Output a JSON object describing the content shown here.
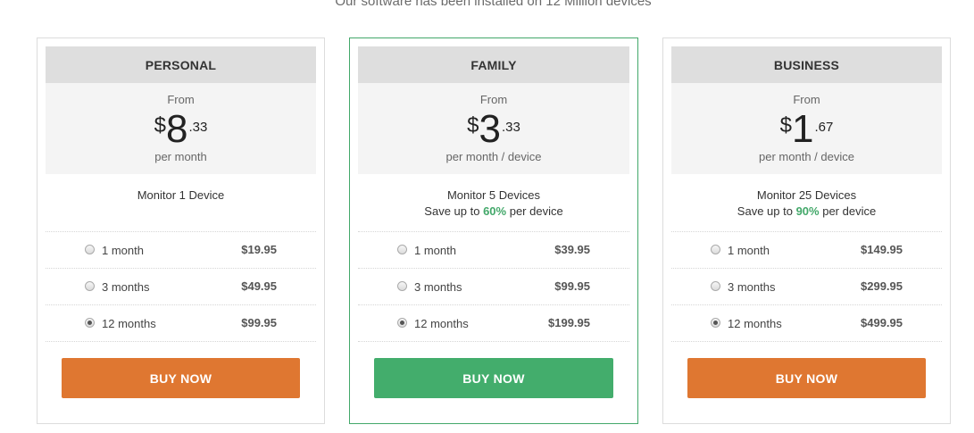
{
  "subtitle": "Our software has been installed on 12 Million devices",
  "colors": {
    "accent_orange": "#df7731",
    "accent_green": "#43ad6c",
    "highlight_pct": "#43a86a"
  },
  "plans": [
    {
      "name": "PERSONAL",
      "from_label": "From",
      "currency": "$",
      "price_whole": "8",
      "price_cents": ".33",
      "period": "per month",
      "desc_line1": "Monitor 1 Device",
      "save_prefix": "",
      "save_pct": "",
      "save_suffix": "",
      "options": [
        {
          "label": "1 month",
          "price": "$19.95",
          "selected": false
        },
        {
          "label": "3 months",
          "price": "$49.95",
          "selected": false
        },
        {
          "label": "12 months",
          "price": "$99.95",
          "selected": true
        }
      ],
      "button": "BUY NOW",
      "button_color": "orange"
    },
    {
      "name": "FAMILY",
      "from_label": "From",
      "currency": "$",
      "price_whole": "3",
      "price_cents": ".33",
      "period": "per month / device",
      "desc_line1": "Monitor 5 Devices",
      "save_prefix": "Save up to ",
      "save_pct": "60%",
      "save_suffix": " per device",
      "options": [
        {
          "label": "1 month",
          "price": "$39.95",
          "selected": false
        },
        {
          "label": "3 months",
          "price": "$99.95",
          "selected": false
        },
        {
          "label": "12 months",
          "price": "$199.95",
          "selected": true
        }
      ],
      "button": "BUY NOW",
      "button_color": "green"
    },
    {
      "name": "BUSINESS",
      "from_label": "From",
      "currency": "$",
      "price_whole": "1",
      "price_cents": ".67",
      "period": "per month / device",
      "desc_line1": "Monitor 25 Devices",
      "save_prefix": "Save up to ",
      "save_pct": "90%",
      "save_suffix": " per device",
      "options": [
        {
          "label": "1 month",
          "price": "$149.95",
          "selected": false
        },
        {
          "label": "3 months",
          "price": "$299.95",
          "selected": false
        },
        {
          "label": "12 months",
          "price": "$499.95",
          "selected": true
        }
      ],
      "button": "BUY NOW",
      "button_color": "orange"
    }
  ]
}
